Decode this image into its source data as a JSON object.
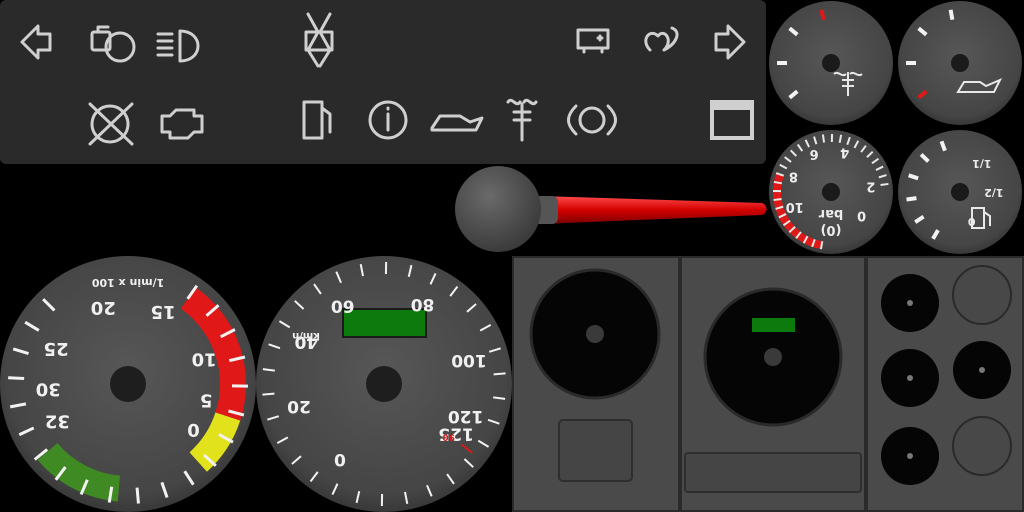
{
  "colors": {
    "background": "#000000",
    "panel": "#2a2a2a",
    "dial_face": "#4a4a4a",
    "dial_edge": "#2c2c2c",
    "tick": "#f2f2f2",
    "zone_red": "#e01818",
    "zone_yellow": "#e2e21c",
    "zone_green": "#3f8a22",
    "lcd_green": "#0c7a0c",
    "needle_red": "#d40000",
    "housing": "#464646"
  },
  "warning_lights": {
    "row1": [
      "turn-left-arrow",
      "engine-preheat",
      "high-beam",
      "diff-lock",
      "trailer-battery",
      "glow-plug",
      "turn-right-arrow"
    ],
    "row2": [
      "no-brake-wear",
      "engine-warning",
      "fuel-filter",
      "info",
      "oil-level",
      "coolant-temperature",
      "parking-brake",
      "cabin-tilt"
    ]
  },
  "rpm_gauge": {
    "unit_label": "1/min x 100",
    "tick_labels": [
      "0",
      "5",
      "10",
      "15",
      "20",
      "25",
      "30",
      "32"
    ],
    "zones": [
      "green",
      "yellow",
      "red"
    ]
  },
  "speed_gauge": {
    "unit_label": "km/h",
    "tick_labels": [
      "0",
      "20",
      "40",
      "60",
      "80",
      "100",
      "120",
      "125"
    ],
    "red_tick_label": "90"
  },
  "air_pressure_gauge": {
    "unit_label": "bar",
    "tick_labels": [
      "0",
      "2",
      "4",
      "6",
      "8",
      "10",
      "(0)"
    ]
  },
  "fuel_gauge": {
    "tick_labels": [
      "0",
      "1/2",
      "1/1"
    ]
  }
}
